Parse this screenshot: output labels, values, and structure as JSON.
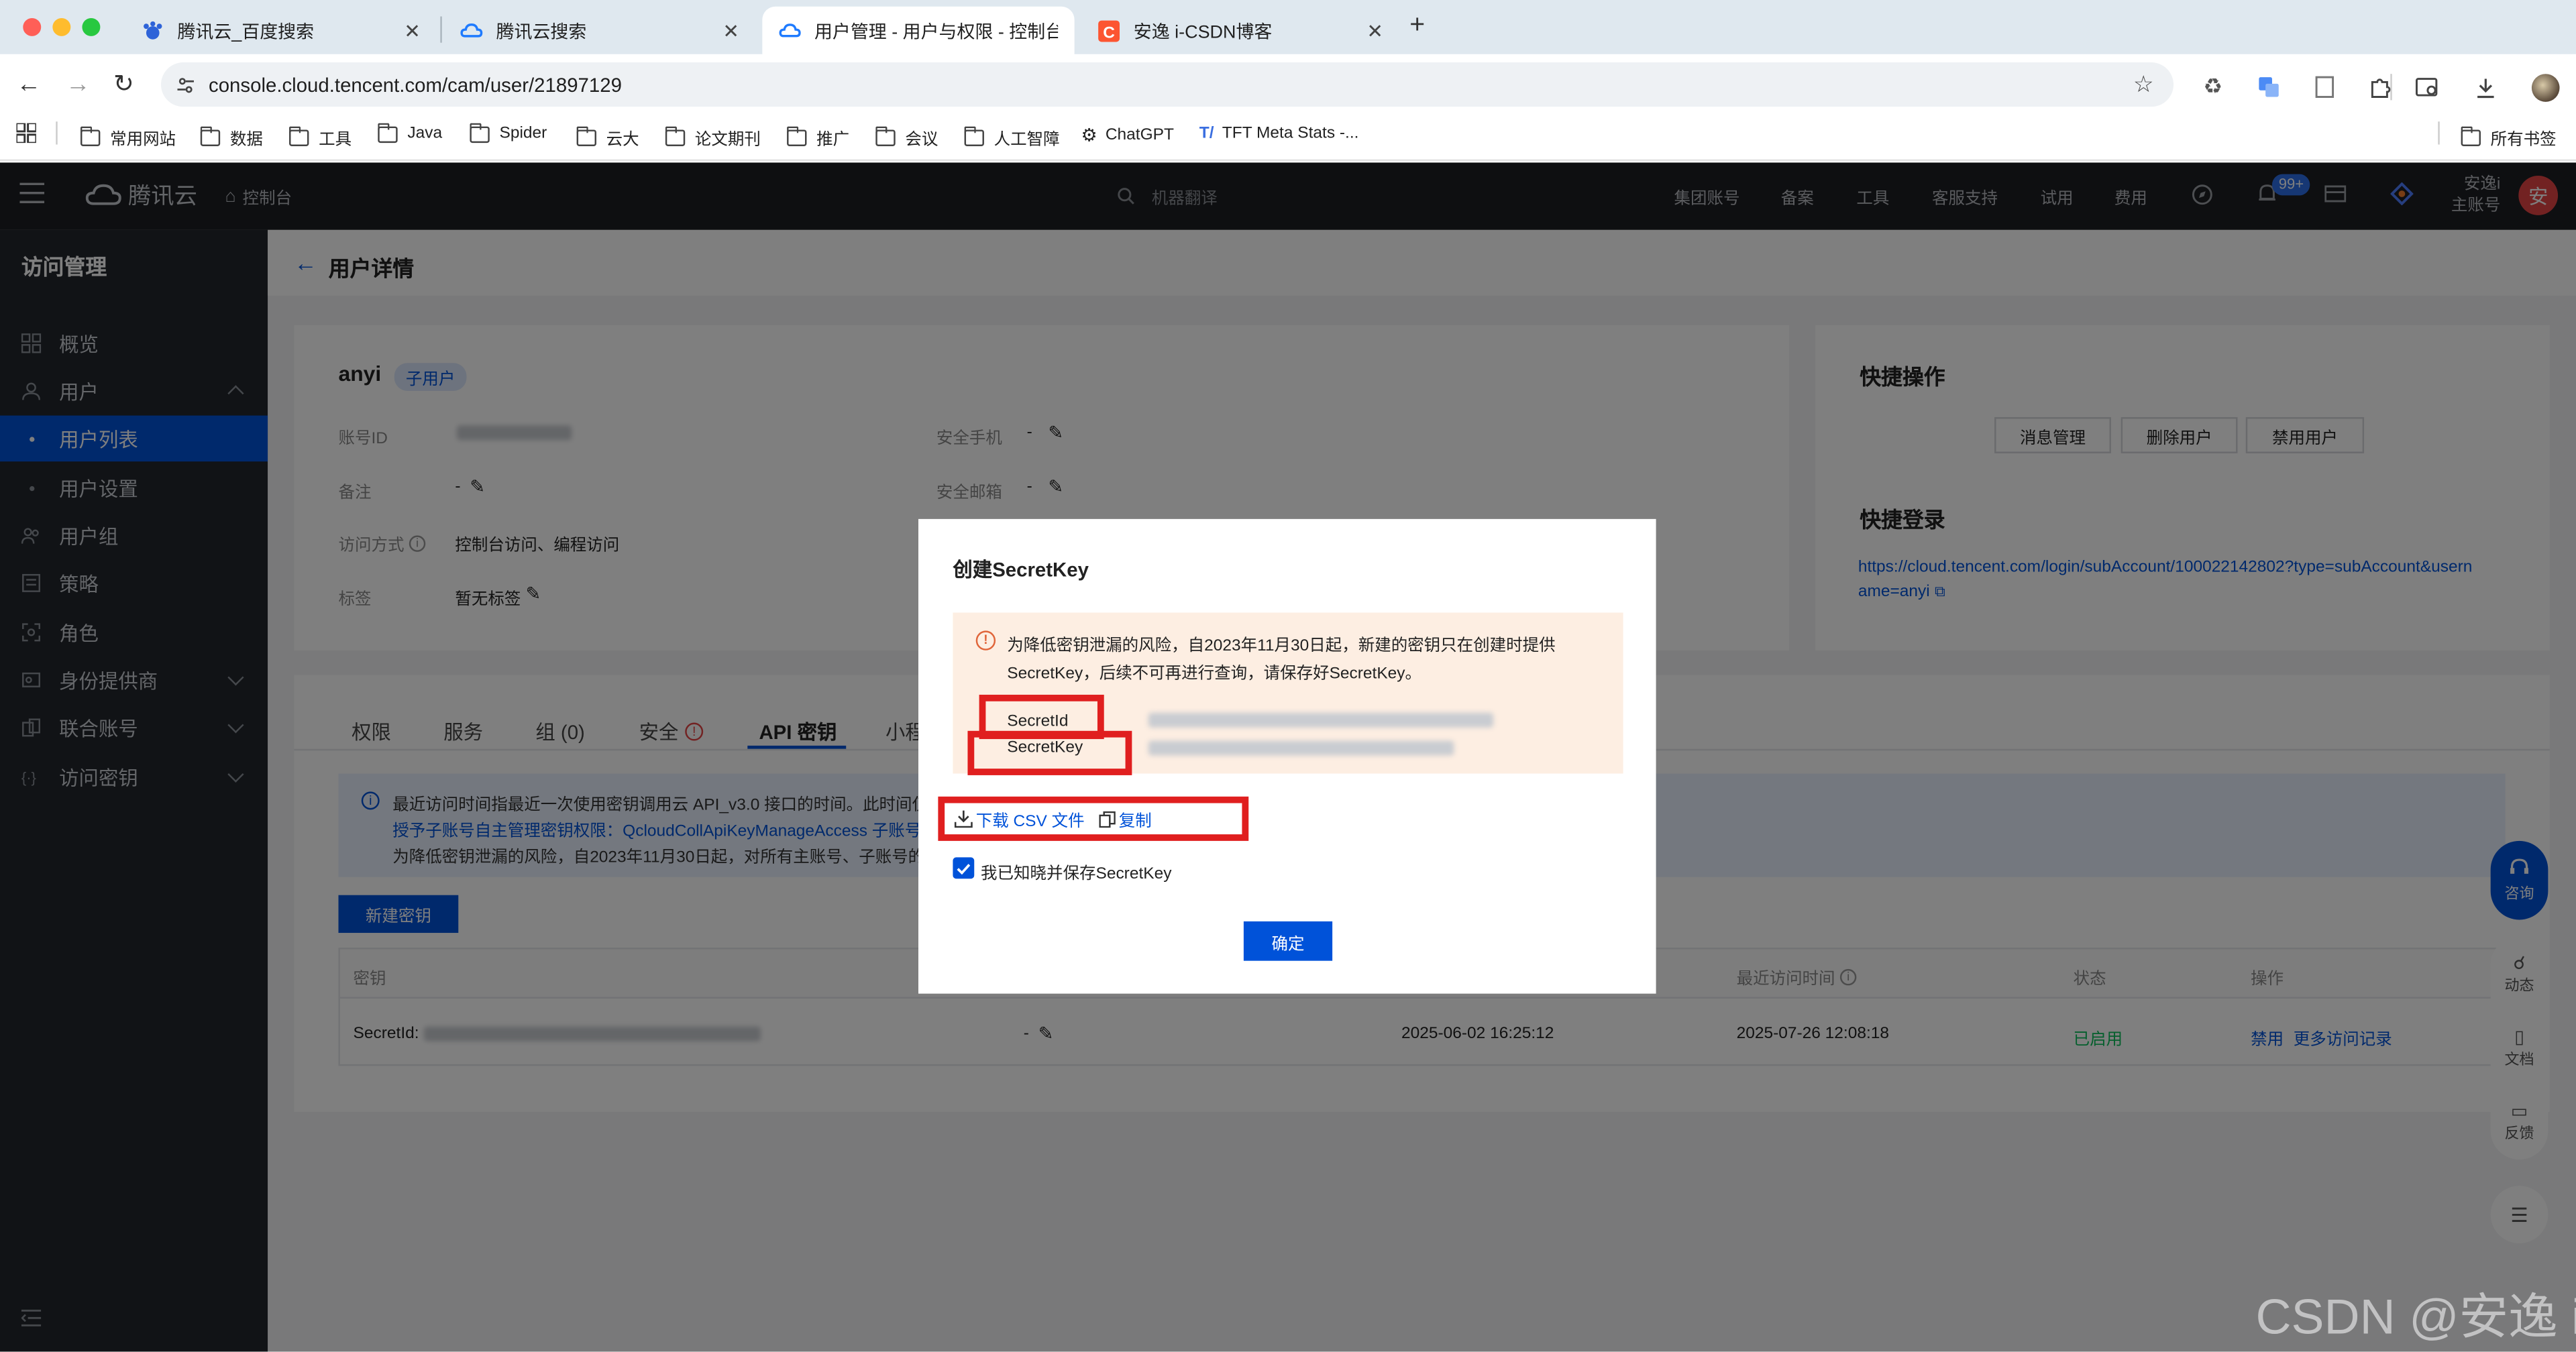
{
  "browser": {
    "tabs": [
      {
        "title": "腾讯云_百度搜索",
        "icon": "baidu-icon",
        "active": false
      },
      {
        "title": "腾讯云搜索",
        "icon": "tencent-cloud-icon",
        "active": false
      },
      {
        "title": "用户管理 - 用户与权限 - 控制台",
        "icon": "tencent-cloud-icon",
        "active": true
      },
      {
        "title": "安逸 i-CSDN博客",
        "icon": "csdn-icon",
        "active": false
      }
    ],
    "url": "console.cloud.tencent.com/cam/user/21897129",
    "bookmarks": [
      "常用网站",
      "数据",
      "工具",
      "Java",
      "Spider",
      "云大",
      "论文期刊",
      "推广",
      "会议",
      "人工智障",
      "ChatGPT",
      "TFT Meta Stats -..."
    ],
    "all_bookmarks": "所有书签"
  },
  "topnav": {
    "brand": "腾讯云",
    "console": "控制台",
    "search": "机器翻译",
    "items": [
      "集团账号",
      "备案",
      "工具",
      "客服支持",
      "试用",
      "费用"
    ],
    "badge": "99+",
    "account_line1": "安逸i",
    "account_line2": "主账号",
    "avatar": "安"
  },
  "sidebar": {
    "title": "访问管理",
    "items": [
      {
        "label": "概览",
        "icon": "grid-icon"
      },
      {
        "label": "用户",
        "icon": "user-icon"
      },
      {
        "label": "用户列表",
        "sub": true,
        "active": true
      },
      {
        "label": "用户设置",
        "sub": true
      },
      {
        "label": "用户组",
        "icon": "users-icon"
      },
      {
        "label": "策略",
        "icon": "policy-icon"
      },
      {
        "label": "角色",
        "icon": "role-icon"
      },
      {
        "label": "身份提供商",
        "icon": "identity-icon"
      },
      {
        "label": "联合账号",
        "icon": "federated-icon"
      },
      {
        "label": "访问密钥",
        "icon": "key-icon"
      }
    ]
  },
  "page": {
    "title": "用户详情",
    "user": {
      "name": "anyi",
      "tag": "子用户",
      "fields": [
        {
          "label": "账号ID",
          "value": ""
        },
        {
          "label": "备注",
          "value": "-"
        },
        {
          "label": "访问方式",
          "value": "控制台访问、编程访问"
        },
        {
          "label": "标签",
          "value": "暂无标签"
        }
      ],
      "fields_right": [
        {
          "label": "安全手机",
          "value": "-"
        },
        {
          "label": "安全邮箱",
          "value": "-"
        }
      ]
    },
    "quick": {
      "title": "快捷操作",
      "buttons": [
        "消息管理",
        "删除用户",
        "禁用用户"
      ],
      "login_title": "快捷登录",
      "login_url_line1": "https://cloud.tencent.com/login/subAccount/100022142802?type=subAccount&usern",
      "login_url_line2": "ame=anyi"
    },
    "tabs": [
      "权限",
      "服务",
      "组 (0)",
      "安全",
      "API 密钥",
      "小程"
    ],
    "info_line1": "最近访问时间指最近一次使用密钥调用云 API_v3.0 接口的时间。此时间仅",
    "info_line2": "授予子账号自主管理密钥权限：QcloudCollApiKeyManageAccess 子账号",
    "info_line3": "为降低密钥泄漏的风险，自2023年11月30日起，对所有主账号、子账号的",
    "new_key": "新建密钥",
    "table": {
      "headers": [
        "密钥",
        "最近访问时间",
        "状态",
        "操作"
      ],
      "row": {
        "key_label": "SecretId:",
        "remark": "-",
        "created": "2025-06-02 16:25:12",
        "last_access": "2025-07-26 12:08:18",
        "status": "已启用",
        "action1": "禁用",
        "action2": "更多访问记录"
      }
    },
    "float": [
      "咨询",
      "动态",
      "文档",
      "反馈"
    ]
  },
  "modal": {
    "title": "创建SecretKey",
    "warning_line1": "为降低密钥泄漏的风险，自2023年11月30日起，新建的密钥只在创建时提供",
    "warning_line2": "SecretKey，后续不可再进行查询，请保存好SecretKey。",
    "secret_id_label": "SecretId",
    "secret_key_label": "SecretKey",
    "download": "下载 CSV 文件",
    "copy": "复制",
    "checkbox_label": "我已知晓并保存SecretKey",
    "checked": true,
    "confirm": "确定"
  },
  "watermark": "CSDN @安逸 i",
  "colors": {
    "accent": "#0052d9",
    "danger": "#e01f1f",
    "warning_bg": "#fdeee2",
    "success": "#0abf5b"
  }
}
